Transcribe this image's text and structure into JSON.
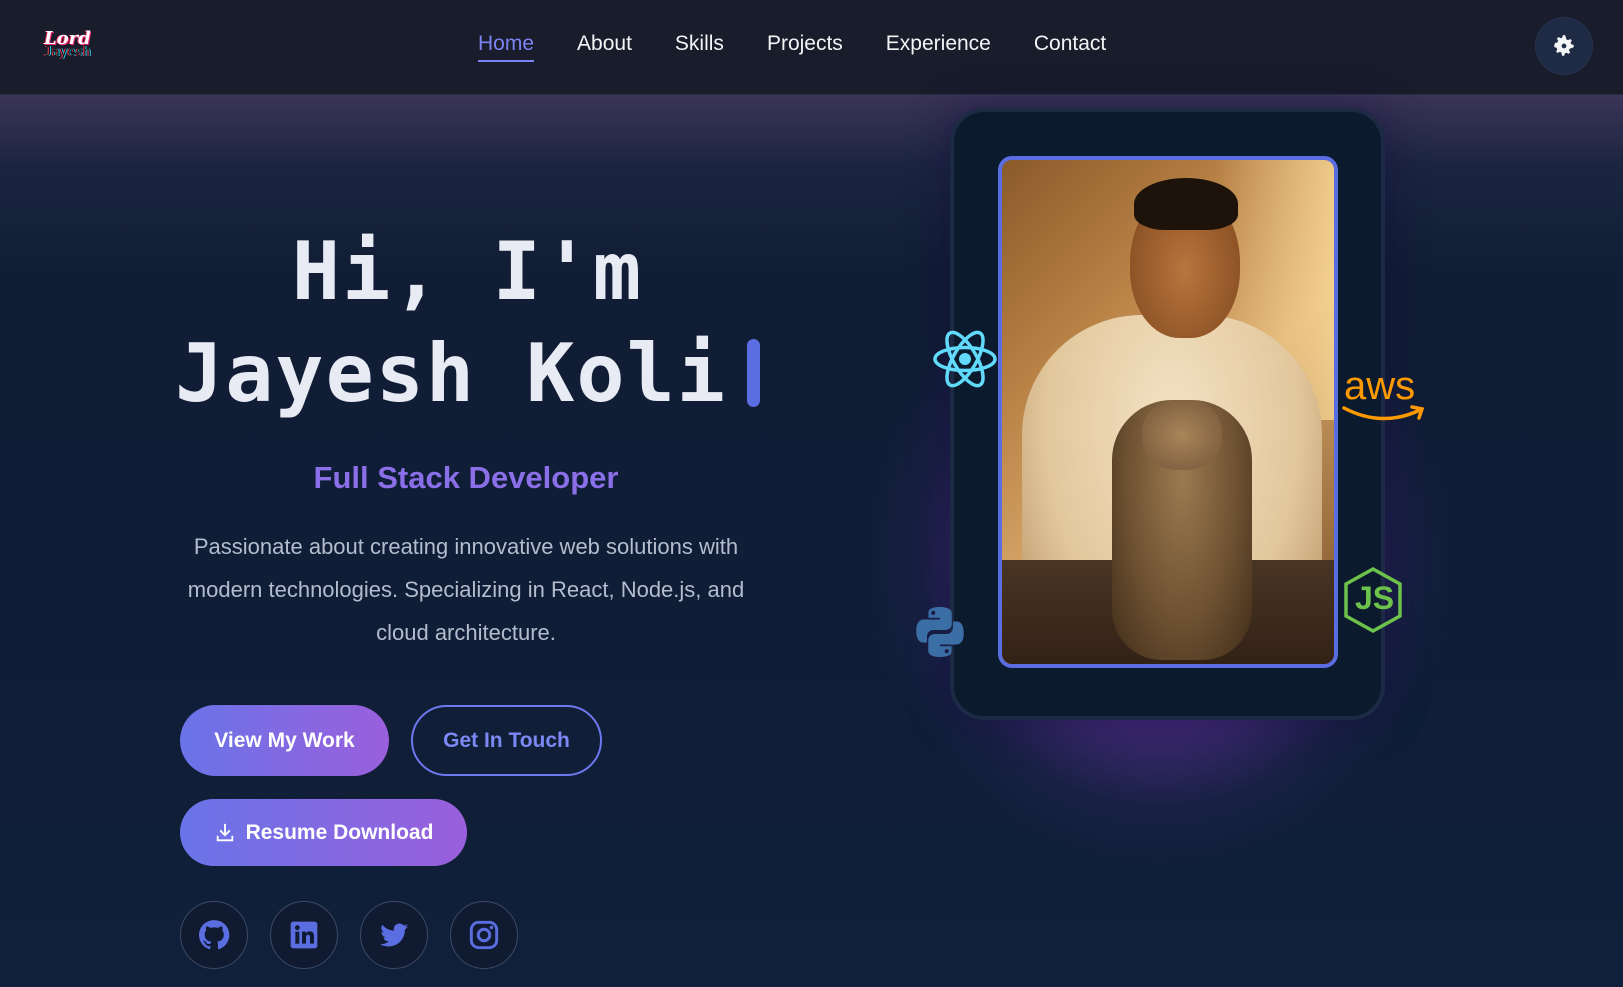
{
  "nav": {
    "logo_top": "Lord",
    "logo_bottom": "Jayesh",
    "links": [
      "Home",
      "About",
      "Skills",
      "Projects",
      "Experience",
      "Contact"
    ],
    "active": "Home",
    "theme_icon": "gear-icon"
  },
  "hero": {
    "greeting": "Hi, I'm",
    "name": "Jayesh Koli",
    "role": "Full Stack Developer",
    "description": "Passionate about creating innovative web solutions with modern technologies. Specializing in React, Node.js, and cloud architecture.",
    "buttons": {
      "primary": "View My Work",
      "secondary": "Get In Touch",
      "resume": "Resume Download"
    },
    "socials": [
      "github-icon",
      "linkedin-icon",
      "twitter-icon",
      "instagram-icon"
    ],
    "tech_icons": [
      "react-icon",
      "aws-icon",
      "python-icon",
      "nodejs-icon"
    ],
    "aws_label": "aws",
    "node_label": "JS"
  },
  "colors": {
    "accent": "#5b6ee1",
    "gradient_start": "#6a74e8",
    "gradient_end": "#9a5fdc",
    "nav_bg": "#181c2b",
    "page_bg": "#0f1d36"
  }
}
